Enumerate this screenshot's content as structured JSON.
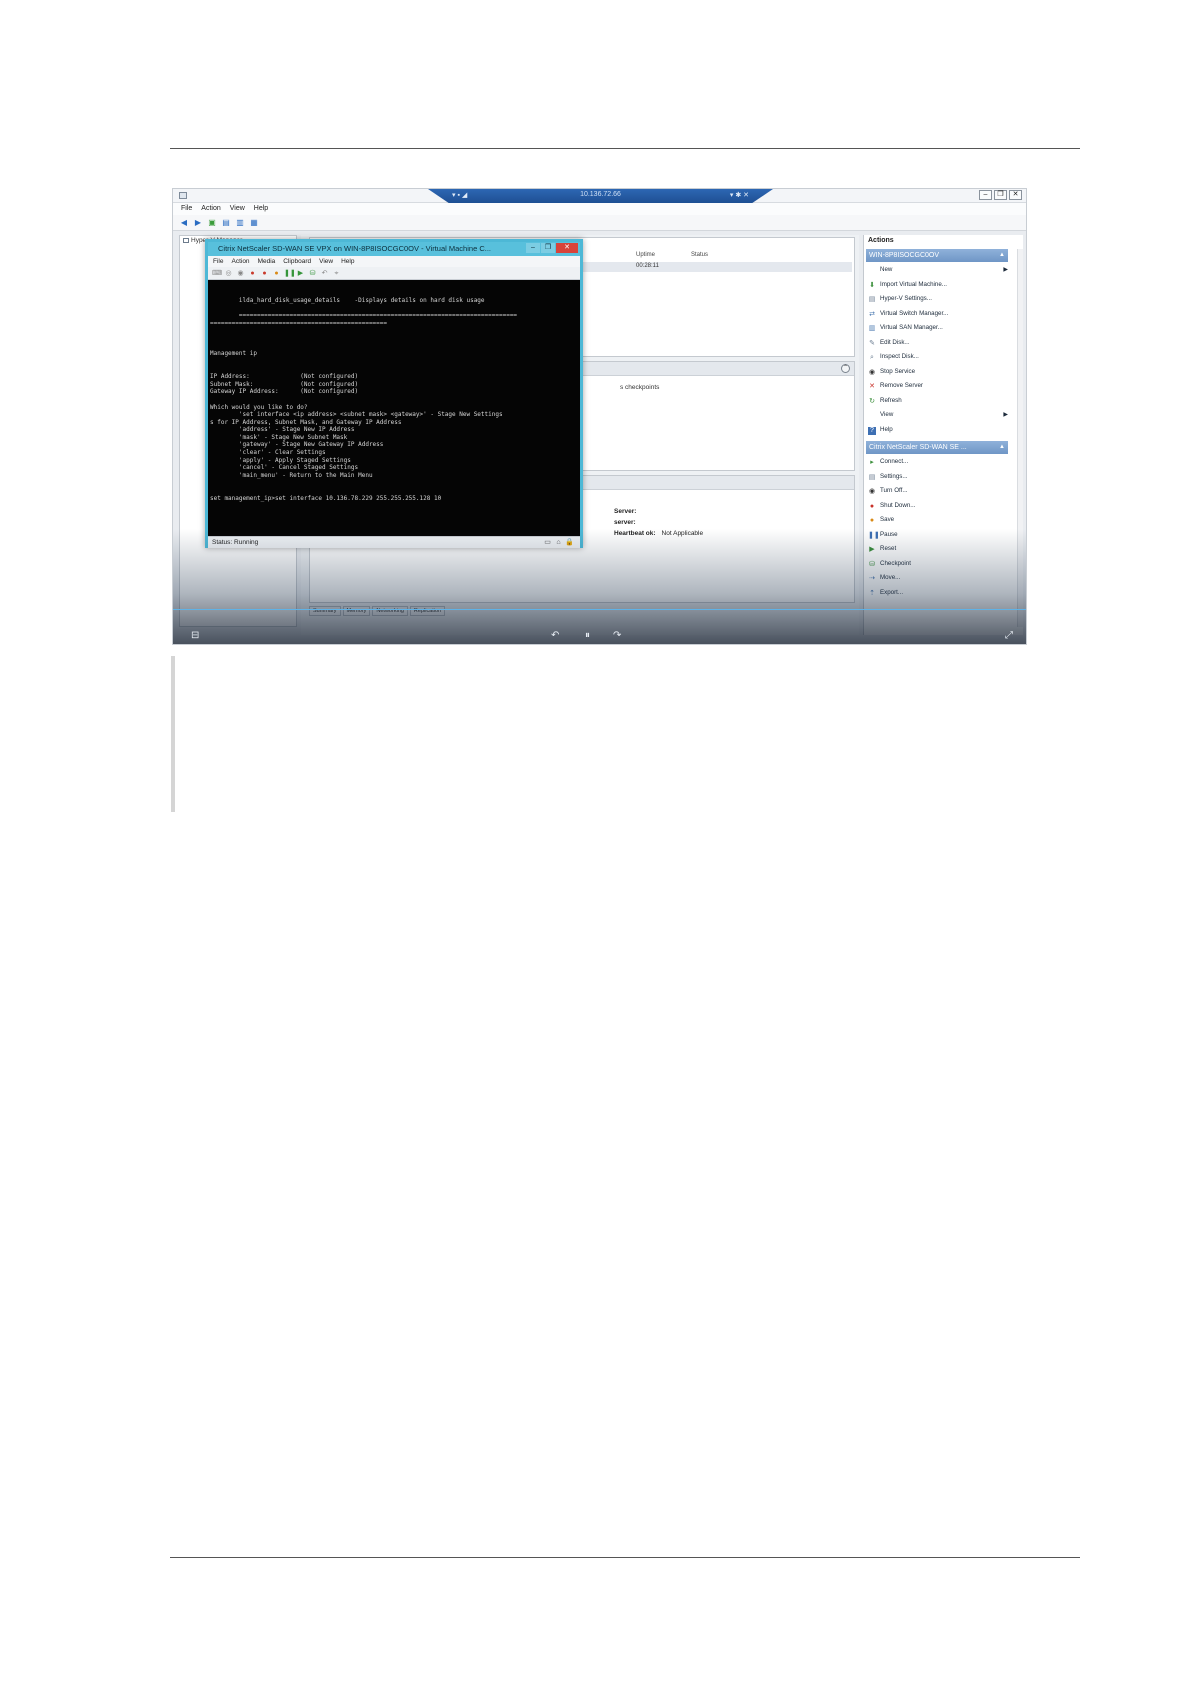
{
  "screenshot": {
    "rdp_title": "10.136.72.66",
    "rdp_left_icons": "▾ ▪ ◢",
    "rdp_right_icons": "▾ ✱ ✕",
    "window_controls": [
      "–",
      "❐",
      "✕"
    ],
    "menu": [
      "File",
      "Action",
      "View",
      "Help"
    ],
    "tree_root": "Hyper-V Manager",
    "vm_list": {
      "col_uptime": "Uptime",
      "col_status": "Status",
      "uptime_value": "00:28:11"
    },
    "checkpoints_text": "s checkpoints",
    "details": [
      {
        "label": "Server:",
        "value": ""
      },
      {
        "label": "server:",
        "value": ""
      },
      {
        "label": "Heartbeat ok:",
        "value": "Not Applicable"
      }
    ],
    "tabs": [
      "Summary",
      "Memory",
      "Networking",
      "Replication"
    ],
    "actions": {
      "title": "Actions",
      "host_section": "WIN-8P8ISOCGC0OV",
      "host_items": [
        {
          "label": "New",
          "icon": "",
          "submenu": true
        },
        {
          "label": "Import Virtual Machine...",
          "icon": "import-icon",
          "submenu": false
        },
        {
          "label": "Hyper-V Settings...",
          "icon": "settings-icon",
          "submenu": false
        },
        {
          "label": "Virtual Switch Manager...",
          "icon": "switch-icon",
          "submenu": false
        },
        {
          "label": "Virtual SAN Manager...",
          "icon": "san-icon",
          "submenu": false
        },
        {
          "label": "Edit Disk...",
          "icon": "edit-disk-icon",
          "submenu": false
        },
        {
          "label": "Inspect Disk...",
          "icon": "inspect-disk-icon",
          "submenu": false
        },
        {
          "label": "Stop Service",
          "icon": "stop-icon",
          "submenu": false
        },
        {
          "label": "Remove Server",
          "icon": "remove-icon",
          "submenu": false
        },
        {
          "label": "Refresh",
          "icon": "refresh-icon",
          "submenu": false
        },
        {
          "label": "View",
          "icon": "",
          "submenu": true
        },
        {
          "label": "Help",
          "icon": "help-icon",
          "submenu": false
        }
      ],
      "vm_section": "Citrix NetScaler SD-WAN SE ...",
      "vm_items": [
        {
          "label": "Connect...",
          "icon": "connect-icon"
        },
        {
          "label": "Settings...",
          "icon": "settings-icon"
        },
        {
          "label": "Turn Off...",
          "icon": "turn-off-icon"
        },
        {
          "label": "Shut Down...",
          "icon": "shut-down-icon"
        },
        {
          "label": "Save",
          "icon": "save-icon"
        },
        {
          "label": "Pause",
          "icon": "pause-icon"
        },
        {
          "label": "Reset",
          "icon": "reset-icon"
        },
        {
          "label": "Checkpoint",
          "icon": "checkpoint-icon"
        },
        {
          "label": "Move...",
          "icon": "move-icon"
        },
        {
          "label": "Export...",
          "icon": "export-icon"
        }
      ]
    },
    "vm_window": {
      "title": "Citrix NetScaler SD-WAN SE VPX on WIN-8P8ISOCGC0OV - Virtual Machine C...",
      "controls": [
        "–",
        "❐",
        "✕"
      ],
      "menu": [
        "File",
        "Action",
        "Media",
        "Clipboard",
        "View",
        "Help"
      ],
      "status": "Status: Running",
      "console_lines": [
        "",
        "",
        "        ilda_hard_disk_usage_details    -Displays details on hard disk usage",
        "",
        "        =============================================================================",
        "=================================================",
        "",
        "",
        "",
        "Management ip",
        "",
        "",
        "IP Address:              (Not configured)",
        "Subnet Mask:             (Not configured)",
        "Gateway IP Address:      (Not configured)",
        "",
        "Which would you like to do?",
        "        'set interface <ip address> <subnet mask> <gateway>' - Stage New Settings",
        "s for IP Address, Subnet Mask, and Gateway IP Address",
        "        'address' - Stage New IP Address",
        "        'mask' - Stage New Subnet Mask",
        "        'gateway' - Stage New Gateway IP Address",
        "        'clear' - Clear Settings",
        "        'apply' - Apply Staged Settings",
        "        'cancel' - Cancel Staged Settings",
        "        'main_menu' - Return to the Main Menu",
        "",
        "",
        "set management_ip>set interface 10.136.78.229 255.255.255.128 10"
      ]
    },
    "video_controls": [
      "⊟",
      "↶",
      "⏸",
      "↷",
      "⤢"
    ],
    "colors": {
      "rdp_bar": "#1e4f93",
      "vm_border": "#4db8d6",
      "vm_close": "#d8433a",
      "actions_header": "#6f96c6",
      "console_bg": "#050505"
    }
  }
}
